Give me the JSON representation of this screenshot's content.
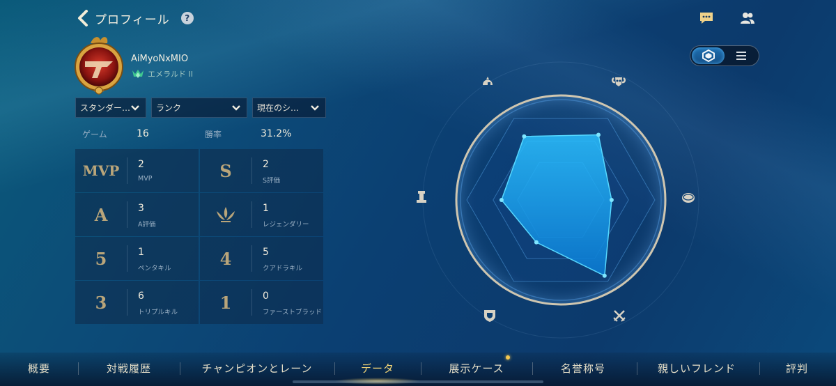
{
  "header": {
    "title": "プロフィール",
    "help_glyph": "?"
  },
  "player": {
    "name": "AiMyoNxMIO",
    "rank": "エメラルド II"
  },
  "filters": [
    {
      "label": "スタンダー…"
    },
    {
      "label": "ランク"
    },
    {
      "label": "現在のシ…"
    }
  ],
  "summary": {
    "games_label": "ゲーム",
    "games_value": "16",
    "winrate_label": "勝率",
    "winrate_value": "31.2%"
  },
  "stats": [
    {
      "icon_text": "MVP",
      "value": "2",
      "label": "MVP"
    },
    {
      "icon_text": "S",
      "value": "2",
      "label": "S評価"
    },
    {
      "icon_text": "A",
      "value": "3",
      "label": "A評価"
    },
    {
      "icon_text": "",
      "icon": "legendary-icon",
      "value": "1",
      "label": "レジェンダリー"
    },
    {
      "icon_text": "5",
      "value": "1",
      "label": "ペンタキル"
    },
    {
      "icon_text": "4",
      "value": "5",
      "label": "クアドラキル"
    },
    {
      "icon_text": "3",
      "value": "6",
      "label": "トリプルキル"
    },
    {
      "icon_text": "1",
      "value": "0",
      "label": "ファーストブラッド"
    }
  ],
  "radar": {
    "axis_icons": [
      "helmet-icon",
      "ram-skull-icon",
      "coin-icon",
      "swords-icon",
      "shield-icon",
      "tower-icon"
    ],
    "values": [
      0.78,
      0.8,
      0.54,
      0.93,
      0.52,
      0.63
    ]
  },
  "view_toggle": {
    "active": "radar-view",
    "options": [
      "radar-view-icon",
      "list-view-icon"
    ]
  },
  "bottom_nav": [
    {
      "label": "概要"
    },
    {
      "label": "対戦履歴"
    },
    {
      "label": "チャンピオンとレーン"
    },
    {
      "label": "データ",
      "active": true
    },
    {
      "label": "展示ケース"
    },
    {
      "label": "名誉称号"
    },
    {
      "label": "親しいフレンド"
    },
    {
      "label": "評判"
    }
  ],
  "colors": {
    "accent_gold": "#f6d878",
    "radar_fill": "#1aa8f0",
    "radar_point": "#7fe6ff",
    "emerald": "#3fc890"
  }
}
